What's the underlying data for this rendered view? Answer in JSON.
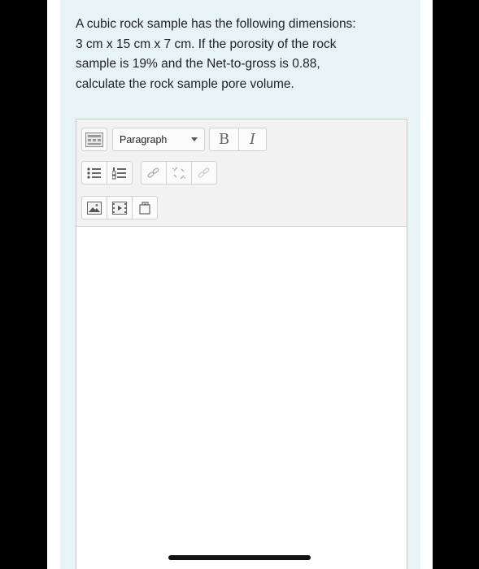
{
  "question": {
    "lines": [
      "A cubic rock sample has the following dimensions:",
      "3 cm x 15 cm x 7 cm. If the porosity of the rock",
      "sample is 19% and the Net-to-gross is 0.88,",
      "calculate the rock sample pore volume."
    ]
  },
  "editor": {
    "paragraph_select": "Paragraph",
    "bold_label": "B",
    "italic_label": "I",
    "icons": [
      "toolbar-toggle-icon",
      "unordered-list-icon",
      "ordered-list-icon",
      "link-icon",
      "unlink-icon",
      "link-disabled-icon",
      "image-icon",
      "media-icon",
      "manage-files-icon"
    ]
  },
  "colors": {
    "card_background": "#e7f3f5",
    "toolbar_background": "#f2f2f2",
    "text": "#1d2125"
  }
}
